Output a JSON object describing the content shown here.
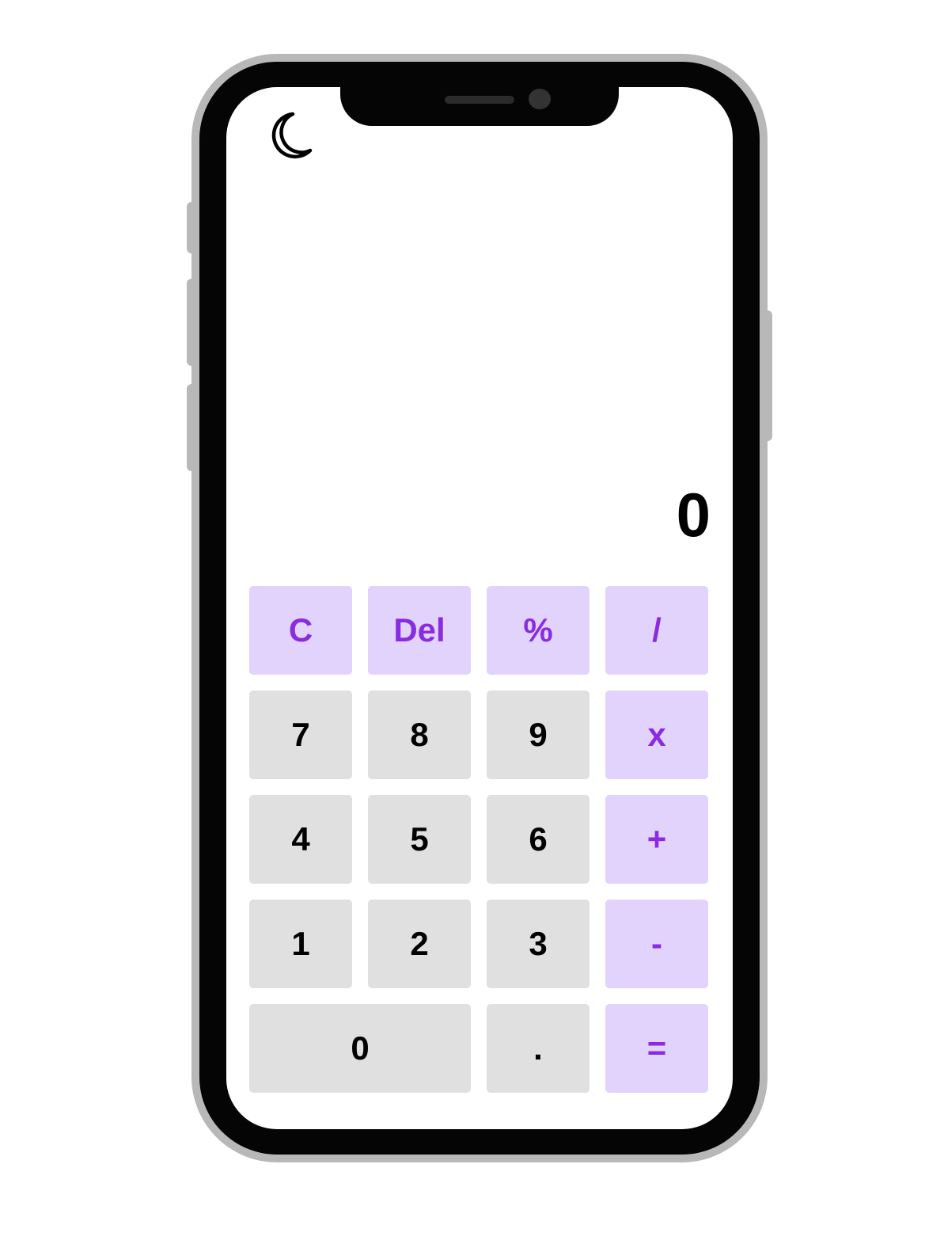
{
  "app": {
    "theme_toggle_icon": "moon-icon"
  },
  "display": {
    "value": "0"
  },
  "colors": {
    "operator_bg": "#e1d3fb",
    "operator_text": "#8a2be2",
    "number_bg": "#e0e0e0",
    "number_text": "#000000"
  },
  "keypad": {
    "keys": [
      {
        "label": "C",
        "kind": "op",
        "name": "clear-button"
      },
      {
        "label": "Del",
        "kind": "op",
        "name": "delete-button"
      },
      {
        "label": "%",
        "kind": "op",
        "name": "percent-button"
      },
      {
        "label": "/",
        "kind": "op",
        "name": "divide-button"
      },
      {
        "label": "7",
        "kind": "num",
        "name": "digit-7-button"
      },
      {
        "label": "8",
        "kind": "num",
        "name": "digit-8-button"
      },
      {
        "label": "9",
        "kind": "num",
        "name": "digit-9-button"
      },
      {
        "label": "x",
        "kind": "op",
        "name": "multiply-button"
      },
      {
        "label": "4",
        "kind": "num",
        "name": "digit-4-button"
      },
      {
        "label": "5",
        "kind": "num",
        "name": "digit-5-button"
      },
      {
        "label": "6",
        "kind": "num",
        "name": "digit-6-button"
      },
      {
        "label": "+",
        "kind": "op",
        "name": "add-button"
      },
      {
        "label": "1",
        "kind": "num",
        "name": "digit-1-button"
      },
      {
        "label": "2",
        "kind": "num",
        "name": "digit-2-button"
      },
      {
        "label": "3",
        "kind": "num",
        "name": "digit-3-button"
      },
      {
        "label": "-",
        "kind": "op",
        "name": "subtract-button"
      },
      {
        "label": "0",
        "kind": "num",
        "name": "digit-0-button",
        "wide": true
      },
      {
        "label": ".",
        "kind": "num",
        "name": "decimal-button"
      },
      {
        "label": "=",
        "kind": "op",
        "name": "equals-button"
      }
    ]
  }
}
